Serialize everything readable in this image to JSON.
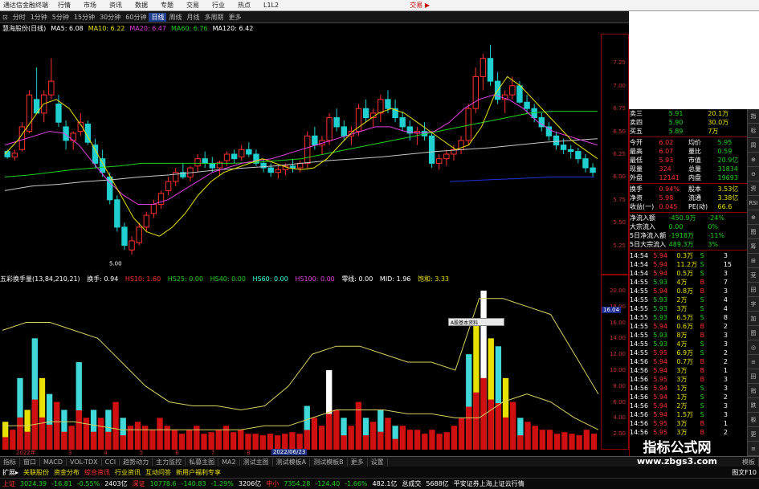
{
  "app": {
    "title": "通达信金融终端",
    "menu": [
      "行情",
      "市场",
      "资讯",
      "数据",
      "专题",
      "交易",
      "行业",
      "热点",
      "L1L2"
    ],
    "trade": "交易 ▶"
  },
  "periods": [
    "分时",
    "1分钟",
    "5分钟",
    "15分钟",
    "30分钟",
    "60分钟",
    "日线",
    "周线",
    "月线",
    "多周期",
    "更多"
  ],
  "active_period": "日线",
  "info": {
    "stock": "慧海股份(日线)",
    "ma5": "MA5: 6.08",
    "ma10": "MA10: 6.22",
    "ma20": "MA20: 6.47",
    "ma60": "MA60: 6.76",
    "ma120": "MA120: 6.42"
  },
  "vol_header": {
    "name": "五彩换手量(13,84,210,21)",
    "hs": "换手: 0.94",
    "hs10": "HS10: 1.60",
    "hs25": "HS25: 0.00",
    "hs40": "HS40: 0.00",
    "hs60": "HS60: 0.00",
    "hs100": "HS100: 0.00",
    "ling": "零线: 0.00",
    "mid": "MID: 1.96",
    "bao": "饱和: 3.33"
  },
  "price_ticks": [
    "7.25",
    "7.00",
    "6.75",
    "6.50",
    "6.25",
    "6.00",
    "5.75",
    "5.50",
    "5.25"
  ],
  "vol_ticks": [
    "20.00",
    "18.00",
    "16.00",
    "14.00",
    "12.00",
    "10.00",
    "8.00",
    "6.00",
    "4.00",
    "2.00"
  ],
  "low_label": "5.00",
  "price_box": "16.04",
  "tooltip": "A股基本资料",
  "date_flag": "2022/06/23",
  "date_strip": [
    "2022年",
    "3",
    "4",
    "5",
    "6",
    "7",
    "8",
    "9"
  ],
  "quote": {
    "top": [
      [
        "卖三",
        "5.91",
        "20.1万"
      ],
      [
        "卖四",
        "5.90",
        "30.0万"
      ],
      [
        "买五",
        "5.89",
        "7万"
      ]
    ],
    "stats": [
      [
        "今开",
        "6.02",
        "均价",
        "5.95"
      ],
      [
        "最高",
        "6.07",
        "量比",
        "0.59"
      ],
      [
        "最低",
        "5.93",
        "市值",
        "20.9亿"
      ],
      [
        "现量",
        "324",
        "总量",
        "31834"
      ],
      [
        "外盘",
        "12141",
        "内盘",
        "19693"
      ]
    ],
    "stats2": [
      [
        "换手",
        "0.94%",
        "股本",
        "3.53亿"
      ],
      [
        "净资",
        "5.98",
        "流通",
        "3.38亿"
      ],
      [
        "收益(一)",
        "0.045",
        "PE(动)",
        "66.6"
      ]
    ],
    "flows": [
      [
        "净流入额",
        "-450.9万",
        "-24%"
      ],
      [
        "大宗流入",
        "0.00",
        "0%"
      ],
      [
        "5日净流入额",
        "-1918万",
        "-11%"
      ],
      [
        "5日大宗流入",
        "489.3万",
        "3%"
      ]
    ],
    "ticks": [
      [
        "14:54",
        "5.94",
        "0.3万",
        "S",
        "3"
      ],
      [
        "14:54",
        "5.94",
        "11.2万",
        "S",
        "15"
      ],
      [
        "14:54",
        "5.94",
        "0.5万",
        "S",
        "3"
      ],
      [
        "14:55",
        "5.93",
        "4万",
        "B",
        "7"
      ],
      [
        "14:55",
        "5.94",
        "0.8万",
        "B",
        "3"
      ],
      [
        "14:55",
        "5.93",
        "2万",
        "S",
        "4"
      ],
      [
        "14:55",
        "5.93",
        "3万",
        "S",
        "4"
      ],
      [
        "14:55",
        "5.93",
        "6.5万",
        "S",
        "8"
      ],
      [
        "14:55",
        "5.94",
        "0.6万",
        "B",
        "2"
      ],
      [
        "14:55",
        "5.93",
        "8万",
        "B",
        "3"
      ],
      [
        "14:55",
        "5.93",
        "4万",
        "S",
        "3"
      ],
      [
        "14:55",
        "5.95",
        "6.9万",
        "S",
        "2"
      ],
      [
        "14:56",
        "5.94",
        "0.7万",
        "B",
        "2"
      ],
      [
        "14:56",
        "5.94",
        "3万",
        "B",
        "1"
      ],
      [
        "14:56",
        "5.95",
        "3万",
        "B",
        "3"
      ],
      [
        "14:56",
        "5.94",
        "1万",
        "S",
        "3"
      ],
      [
        "14:56",
        "5.94",
        "1万",
        "S",
        "2"
      ],
      [
        "14:56",
        "5.94",
        "2万",
        "S",
        "3"
      ],
      [
        "14:56",
        "5.94",
        "1.5万",
        "S",
        "3"
      ],
      [
        "14:56",
        "5.95",
        "3万",
        "B",
        "1"
      ],
      [
        "14:56",
        "5.95",
        "3万",
        "B",
        "2"
      ]
    ]
  },
  "right_tools": [
    "指",
    "标",
    "周",
    "⊕",
    "⊖",
    "资",
    "RSI",
    "⊕",
    "图",
    "筹",
    "⊞",
    "竞",
    "田",
    "字",
    "加",
    "图",
    "◎",
    "≡",
    "田",
    "指",
    "跌",
    "板",
    "更",
    "≡"
  ],
  "bottom_tabs": [
    "指标",
    "窗口",
    "MACD",
    "VOL-TDX",
    "CCI",
    "趋势动力",
    "主力监控",
    "私募主图",
    "MA2",
    "测试主图",
    "测试模板A",
    "测试模板B",
    "更多",
    "设置",
    "模板"
  ],
  "ticker1": {
    "s1": "扩展▸",
    "s2": "关联股份",
    "s3": "资金分布",
    "s4": "综合资讯",
    "s5": "行业资讯",
    "s6": "互动问答",
    "s7": "新用户福利专享",
    "s8": "图文F10"
  },
  "ticker2": {
    "sh": "上证",
    "sh_v": "3024.39",
    "sh_c": "-16.81",
    "sh_p": "-0.55%",
    "sh_a": "2403亿",
    "sz": "深证",
    "sz_v": "10778.6",
    "sz_c": "-140.83",
    "sz_p": "-1.29%",
    "sz_a": "3206亿",
    "zx": "中小",
    "zx_v": "7354.28",
    "zx_c": "-124.40",
    "zx_p": "-1.66%",
    "zx_a": "482.1亿",
    "tot": "总成交",
    "tot_v": "5688亿",
    "news": "平安证券上海上证云行情"
  },
  "watermark": {
    "l1": "指标公式网",
    "l2": "www.zbgs3.com"
  },
  "colors": {
    "up": "#ff3030",
    "down": "#20d0d0",
    "vol_yellow": "#e8e000",
    "vol_red": "#d01010",
    "ma5": "#ffffff",
    "ma10": "#e8e000",
    "ma20": "#e040e0",
    "ma60": "#20d020",
    "ma120": "#c8c8c8",
    "band": "#d8d060",
    "grid": "#8b0000"
  },
  "chart_data": {
    "type": "candlestick",
    "ylim": [
      5.0,
      7.5
    ],
    "candles": [
      [
        6.28,
        6.3,
        6.2,
        6.22
      ],
      [
        6.22,
        6.3,
        6.18,
        6.26
      ],
      [
        6.3,
        6.6,
        6.28,
        6.55
      ],
      [
        6.5,
        6.95,
        6.48,
        6.9
      ],
      [
        6.85,
        7.2,
        6.8,
        6.7
      ],
      [
        6.7,
        6.95,
        6.6,
        6.9
      ],
      [
        6.9,
        7.3,
        6.85,
        7.05
      ],
      [
        6.8,
        6.9,
        6.55,
        6.6
      ],
      [
        6.55,
        6.62,
        6.3,
        6.4
      ],
      [
        6.4,
        6.5,
        6.3,
        6.48
      ],
      [
        6.5,
        6.7,
        6.45,
        6.6
      ],
      [
        6.58,
        6.62,
        6.35,
        6.38
      ],
      [
        6.35,
        6.42,
        6.1,
        6.15
      ],
      [
        6.2,
        6.3,
        6.0,
        6.05
      ],
      [
        6.0,
        6.05,
        5.7,
        5.75
      ],
      [
        5.75,
        5.8,
        5.4,
        5.45
      ],
      [
        5.45,
        5.5,
        5.2,
        5.25
      ],
      [
        5.2,
        5.35,
        5.15,
        5.3
      ],
      [
        5.28,
        5.5,
        5.25,
        5.45
      ],
      [
        5.45,
        5.62,
        5.4,
        5.58
      ],
      [
        5.6,
        5.75,
        5.55,
        5.7
      ],
      [
        5.7,
        5.85,
        5.65,
        5.82
      ],
      [
        5.85,
        6.0,
        5.8,
        5.95
      ],
      [
        5.95,
        6.1,
        5.9,
        6.05
      ],
      [
        6.05,
        6.15,
        5.98,
        6.0
      ],
      [
        6.0,
        6.12,
        5.95,
        6.1
      ],
      [
        6.12,
        6.25,
        6.05,
        6.2
      ],
      [
        6.2,
        6.28,
        6.1,
        6.15
      ],
      [
        6.15,
        6.22,
        6.05,
        6.1
      ],
      [
        6.1,
        6.18,
        6.02,
        6.16
      ],
      [
        6.18,
        6.28,
        6.12,
        6.25
      ],
      [
        6.25,
        6.3,
        6.15,
        6.2
      ],
      [
        6.22,
        6.35,
        6.18,
        6.3
      ],
      [
        6.3,
        6.38,
        6.22,
        6.25
      ],
      [
        6.25,
        6.3,
        6.12,
        6.15
      ],
      [
        6.15,
        6.2,
        6.05,
        6.1
      ],
      [
        6.1,
        6.15,
        6.0,
        6.05
      ],
      [
        6.05,
        6.12,
        5.98,
        6.08
      ],
      [
        6.08,
        6.15,
        6.02,
        6.12
      ],
      [
        6.12,
        6.2,
        6.05,
        6.1
      ],
      [
        6.1,
        6.18,
        6.05,
        6.15
      ],
      [
        6.15,
        6.5,
        6.1,
        6.45
      ],
      [
        6.45,
        6.55,
        6.3,
        6.35
      ],
      [
        6.35,
        6.45,
        6.25,
        6.4
      ],
      [
        6.4,
        6.7,
        6.35,
        6.65
      ],
      [
        6.65,
        6.75,
        6.5,
        6.55
      ],
      [
        6.55,
        6.62,
        6.4,
        6.45
      ],
      [
        6.45,
        6.55,
        6.35,
        6.5
      ],
      [
        6.5,
        6.8,
        6.45,
        6.75
      ],
      [
        6.75,
        6.85,
        6.6,
        6.65
      ],
      [
        6.65,
        6.75,
        6.55,
        6.7
      ],
      [
        6.7,
        6.9,
        6.6,
        6.85
      ],
      [
        6.85,
        6.95,
        6.7,
        6.75
      ],
      [
        6.75,
        6.85,
        6.6,
        6.65
      ],
      [
        6.65,
        6.72,
        6.5,
        6.55
      ],
      [
        6.55,
        6.62,
        6.4,
        6.48
      ],
      [
        6.48,
        6.55,
        6.35,
        6.5
      ],
      [
        6.5,
        6.6,
        6.4,
        6.45
      ],
      [
        6.45,
        6.5,
        6.1,
        6.15
      ],
      [
        6.15,
        6.25,
        6.08,
        6.2
      ],
      [
        6.2,
        6.3,
        6.12,
        6.25
      ],
      [
        6.25,
        6.35,
        6.18,
        6.3
      ],
      [
        6.3,
        6.45,
        6.25,
        6.4
      ],
      [
        6.4,
        6.8,
        6.35,
        6.75
      ],
      [
        6.75,
        7.2,
        6.7,
        7.1
      ],
      [
        7.1,
        7.35,
        6.95,
        7.3
      ],
      [
        7.3,
        7.45,
        7.0,
        7.05
      ],
      [
        7.05,
        7.15,
        6.8,
        6.85
      ],
      [
        6.85,
        6.95,
        6.7,
        6.9
      ],
      [
        6.9,
        7.1,
        6.85,
        7.0
      ],
      [
        7.0,
        7.05,
        6.8,
        6.82
      ],
      [
        6.82,
        6.9,
        6.7,
        6.75
      ],
      [
        6.75,
        6.8,
        6.6,
        6.65
      ],
      [
        6.65,
        6.7,
        6.5,
        6.55
      ],
      [
        6.55,
        6.6,
        6.4,
        6.45
      ],
      [
        6.45,
        6.5,
        6.3,
        6.35
      ],
      [
        6.35,
        6.42,
        6.25,
        6.3
      ],
      [
        6.3,
        6.35,
        6.2,
        6.28
      ],
      [
        6.28,
        6.32,
        6.15,
        6.2
      ],
      [
        6.2,
        6.25,
        6.05,
        6.1
      ],
      [
        6.1,
        6.15,
        6.0,
        6.05
      ]
    ],
    "volumes": [
      [
        3.5,
        "y"
      ],
      [
        2.5,
        "r"
      ],
      [
        9,
        "c"
      ],
      [
        5,
        "y"
      ],
      [
        14,
        "c"
      ],
      [
        9,
        "y"
      ],
      [
        7,
        "c"
      ],
      [
        6,
        "r"
      ],
      [
        5,
        "c"
      ],
      [
        3,
        "r"
      ],
      [
        11,
        "c"
      ],
      [
        4,
        "r"
      ],
      [
        5,
        "c"
      ],
      [
        4,
        "r"
      ],
      [
        5,
        "c"
      ],
      [
        6,
        "r"
      ],
      [
        4,
        "c"
      ],
      [
        3,
        "r"
      ],
      [
        3.5,
        "r"
      ],
      [
        3,
        "r"
      ],
      [
        2.5,
        "r"
      ],
      [
        4,
        "r"
      ],
      [
        3,
        "r"
      ],
      [
        2.5,
        "r"
      ],
      [
        2,
        "r"
      ],
      [
        2.5,
        "r"
      ],
      [
        3,
        "r"
      ],
      [
        2,
        "r"
      ],
      [
        2.2,
        "r"
      ],
      [
        2.5,
        "r"
      ],
      [
        3,
        "r"
      ],
      [
        2.2,
        "r"
      ],
      [
        2.5,
        "r"
      ],
      [
        2,
        "r"
      ],
      [
        2,
        "r"
      ],
      [
        1.8,
        "r"
      ],
      [
        2,
        "r"
      ],
      [
        1.8,
        "r"
      ],
      [
        2,
        "r"
      ],
      [
        2.2,
        "r"
      ],
      [
        2,
        "r"
      ],
      [
        5.5,
        "c"
      ],
      [
        4,
        "r"
      ],
      [
        3,
        "r"
      ],
      [
        10,
        "w"
      ],
      [
        5,
        "r"
      ],
      [
        4,
        "c"
      ],
      [
        3,
        "r"
      ],
      [
        6,
        "r"
      ],
      [
        4,
        "c"
      ],
      [
        3.5,
        "r"
      ],
      [
        5,
        "c"
      ],
      [
        4,
        "r"
      ],
      [
        3,
        "c"
      ],
      [
        3,
        "r"
      ],
      [
        2.5,
        "r"
      ],
      [
        2.5,
        "r"
      ],
      [
        2,
        "r"
      ],
      [
        2.5,
        "r"
      ],
      [
        2,
        "r"
      ],
      [
        2.2,
        "r"
      ],
      [
        3,
        "r"
      ],
      [
        4,
        "r"
      ],
      [
        12,
        "c"
      ],
      [
        16,
        "y"
      ],
      [
        20,
        "w"
      ],
      [
        14,
        "y"
      ],
      [
        13,
        "c"
      ],
      [
        9,
        "y"
      ],
      [
        6,
        "r"
      ],
      [
        4,
        "c"
      ],
      [
        3.5,
        "r"
      ],
      [
        3,
        "r"
      ],
      [
        2.5,
        "r"
      ],
      [
        2.5,
        "r"
      ],
      [
        2,
        "r"
      ],
      [
        2.2,
        "r"
      ],
      [
        2,
        "r"
      ],
      [
        1.8,
        "r"
      ],
      [
        2.5,
        "r"
      ],
      [
        2,
        "r"
      ]
    ],
    "ma_lines": {
      "ma5": [
        6.25,
        6.4,
        6.6,
        6.8,
        6.85,
        6.75,
        6.55,
        6.3,
        6.05,
        5.8,
        5.55,
        5.4,
        5.35,
        5.45,
        5.6,
        5.8,
        5.95,
        6.05,
        6.1,
        6.15,
        6.2,
        6.15,
        6.1,
        6.08,
        6.1,
        6.2,
        6.35,
        6.5,
        6.6,
        6.7,
        6.75,
        6.7,
        6.6,
        6.5,
        6.4,
        6.3,
        6.35,
        6.55,
        6.9,
        7.1,
        7.0,
        6.85,
        6.7,
        6.55,
        6.4,
        6.3,
        6.2
      ],
      "ma20": [
        6.35,
        6.4,
        6.45,
        6.5,
        6.48,
        6.35,
        6.15,
        5.95,
        5.8,
        5.7,
        5.7,
        5.75,
        5.85,
        5.95,
        6.05,
        6.1,
        6.15,
        6.18,
        6.2,
        6.25,
        6.3,
        6.35,
        6.4,
        6.45,
        6.5,
        6.55,
        6.55,
        6.5,
        6.48,
        6.5,
        6.6,
        6.75,
        6.85,
        6.9,
        6.85,
        6.75,
        6.6,
        6.5,
        6.45,
        6.4,
        6.35
      ],
      "ma60": [
        6.0,
        6.02,
        6.05,
        6.08,
        6.1,
        6.12,
        6.15,
        6.15,
        6.15,
        6.15,
        6.15,
        6.16,
        6.18,
        6.2,
        6.25,
        6.3,
        6.35,
        6.4,
        6.45,
        6.5,
        6.55,
        6.6,
        6.65,
        6.7,
        6.72,
        6.72,
        6.72
      ],
      "ma120": [
        5.85,
        5.9,
        5.92,
        5.95,
        5.97,
        6.0,
        6.02,
        6.05,
        6.08,
        6.1,
        6.12,
        6.15,
        6.18,
        6.2,
        6.22,
        6.25,
        6.28,
        6.3,
        6.32,
        6.35,
        6.38,
        6.4,
        6.42
      ],
      "ma250": [
        5.95,
        5.96,
        5.97,
        5.98,
        5.99,
        6.0,
        6.0,
        6.0
      ]
    },
    "band": {
      "upper": [
        15,
        16,
        16,
        15,
        14,
        11,
        8,
        6,
        5.5,
        5.5,
        5,
        5.5,
        8,
        12,
        13,
        13,
        12,
        11,
        11,
        10,
        19,
        19,
        18,
        17,
        12,
        7
      ],
      "lower": [
        3,
        3,
        3.5,
        3.5,
        3,
        2.5,
        2.5,
        2.5,
        2.5,
        2.5,
        2.5,
        3,
        3,
        4,
        5,
        5,
        5,
        4.5,
        4.5,
        4,
        4,
        6,
        7,
        6,
        4,
        2.5
      ]
    }
  }
}
